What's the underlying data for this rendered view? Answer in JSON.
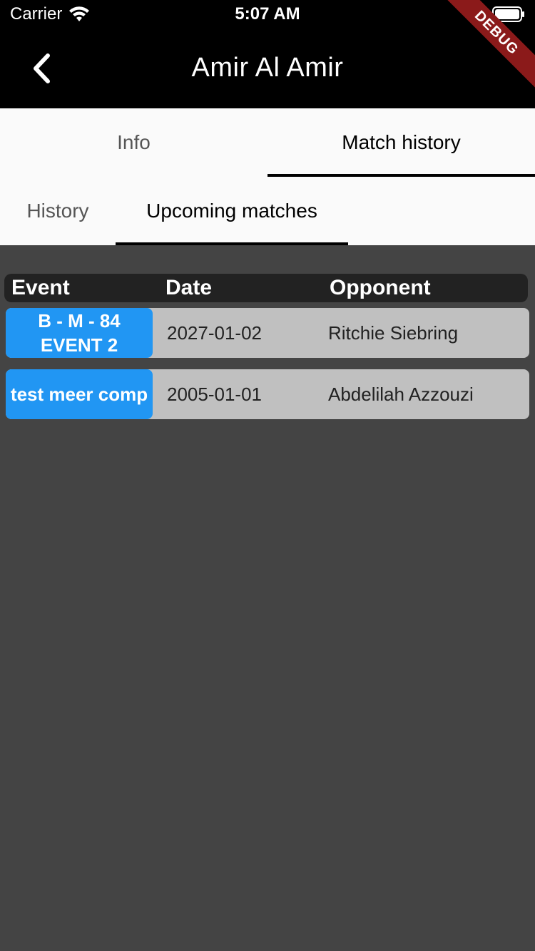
{
  "status_bar": {
    "carrier": "Carrier",
    "time": "5:07 AM",
    "icons": [
      "wifi-icon",
      "battery-icon"
    ]
  },
  "nav": {
    "title": "Amir Al Amir",
    "back_icon": "chevron-left-icon"
  },
  "debug_banner": "DEBUG",
  "main_tabs": [
    {
      "label": "Info",
      "active": false
    },
    {
      "label": "Match history",
      "active": true
    }
  ],
  "sub_tabs": [
    {
      "label": "History",
      "active": false
    },
    {
      "label": "Upcoming matches",
      "active": true
    }
  ],
  "table": {
    "headers": {
      "event": "Event",
      "date": "Date",
      "opponent": "Opponent"
    },
    "rows": [
      {
        "event": "B - M - 84 EVENT 2",
        "date": "2027-01-02",
        "opponent": "Ritchie Siebring"
      },
      {
        "event": "test meer comp",
        "date": "2005-01-01",
        "opponent": "Abdelilah Azzouzi"
      }
    ]
  },
  "colors": {
    "app_bar": "#000000",
    "background": "#444444",
    "tab_bar": "#fafafa",
    "event_badge": "#2196f3",
    "row": "#c0c0c0",
    "table_header": "#222222",
    "debug_ribbon": "#8b1a1a"
  }
}
